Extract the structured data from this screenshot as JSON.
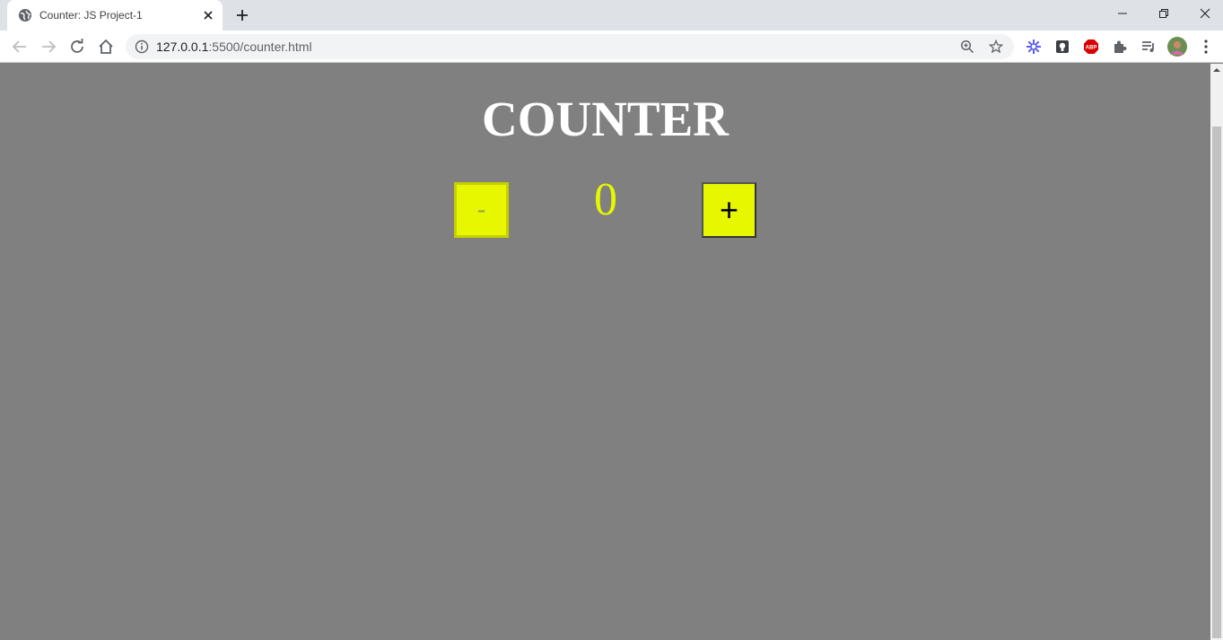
{
  "tab": {
    "title": "Counter: JS Project-1",
    "favicon": "globe-icon"
  },
  "address_bar": {
    "host": "127.0.0.1",
    "rest": ":5500/counter.html"
  },
  "page": {
    "heading": "COUNTER",
    "minus_label": "-",
    "count": "0",
    "plus_label": "+"
  },
  "colors": {
    "page_background": "#808080",
    "button_fill": "#e6f700",
    "count_color": "#e6f700",
    "heading_color": "#ffffff"
  }
}
